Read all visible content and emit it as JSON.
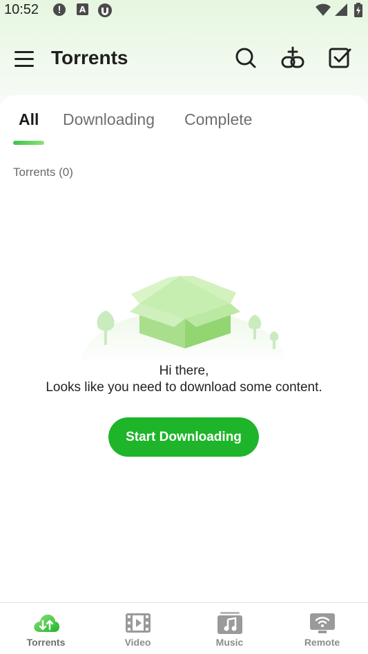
{
  "status_bar": {
    "time": "10:52",
    "left_icons": [
      "alert-icon",
      "font-a-icon",
      "utorrent-icon"
    ],
    "right_icons": [
      "wifi-icon",
      "signal-icon",
      "battery-icon"
    ]
  },
  "app_bar": {
    "title": "Torrents",
    "actions": [
      "search-icon",
      "add-link-icon",
      "select-checkbox-icon"
    ]
  },
  "tabs": [
    {
      "label": "All",
      "active": true
    },
    {
      "label": "Downloading",
      "active": false
    },
    {
      "label": "Complete",
      "active": false
    }
  ],
  "list": {
    "count_label": "Torrents (0)"
  },
  "empty_state": {
    "line1": "Hi there,",
    "line2": "Looks like you need to download some content.",
    "button_label": "Start Downloading"
  },
  "bottom_nav": [
    {
      "label": "Torrents",
      "icon": "cloud-transfer-icon",
      "active": true
    },
    {
      "label": "Video",
      "icon": "film-icon",
      "active": false
    },
    {
      "label": "Music",
      "icon": "music-icon",
      "active": false
    },
    {
      "label": "Remote",
      "icon": "remote-wifi-icon",
      "active": false
    }
  ],
  "colors": {
    "accent": "#1eb52a",
    "accent_light": "#8de27a",
    "nav_inactive": "#8c8c8c"
  }
}
